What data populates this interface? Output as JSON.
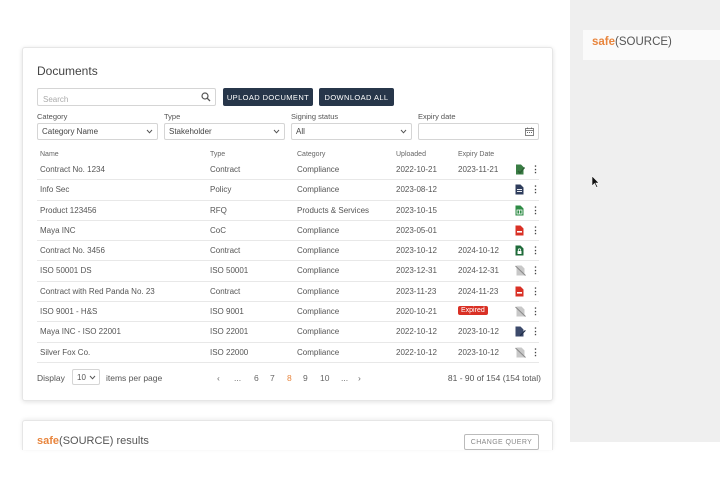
{
  "brand": {
    "safe": "safe",
    "source": "(SOURCE)"
  },
  "documents": {
    "title": "Documents",
    "search_placeholder": "Search",
    "upload_label": "UPLOAD DOCUMENT",
    "download_label": "DOWNLOAD ALL",
    "filters": {
      "category": {
        "label": "Category",
        "value": "Category Name"
      },
      "type": {
        "label": "Type",
        "value": "Stakeholder"
      },
      "signing": {
        "label": "Signing status",
        "value": "All"
      },
      "expiry": {
        "label": "Expiry date",
        "value": ""
      }
    },
    "columns": {
      "name": "Name",
      "type": "Type",
      "category": "Category",
      "uploaded": "Uploaded",
      "expiry": "Expiry Date"
    },
    "rows": [
      {
        "name": "Contract No. 1234",
        "type": "Contract",
        "category": "Compliance",
        "uploaded": "2022-10-21",
        "expiry": "2023-11-21",
        "expired": "",
        "icon": "doc-signed-icon"
      },
      {
        "name": "Info Sec",
        "type": "Policy",
        "category": "Compliance",
        "uploaded": "2023-08-12",
        "expiry": "",
        "expired": "",
        "icon": "doc-file-icon"
      },
      {
        "name": "Product 123456",
        "type": "RFQ",
        "category": "Products & Services",
        "uploaded": "2023-10-15",
        "expiry": "",
        "expired": "",
        "icon": "spreadsheet-file-icon"
      },
      {
        "name": "Maya INC",
        "type": "CoC",
        "category": "Compliance",
        "uploaded": "2023-05-01",
        "expiry": "",
        "expired": "",
        "icon": "pdf-file-icon"
      },
      {
        "name": "Contract No. 3456",
        "type": "Contract",
        "category": "Compliance",
        "uploaded": "2023-10-12",
        "expiry": "2024-10-12",
        "expired": "",
        "icon": "spreadsheet-lock-icon"
      },
      {
        "name": "ISO 50001 DS",
        "type": "ISO 50001",
        "category": "Compliance",
        "uploaded": "2023-12-31",
        "expiry": "2024-12-31",
        "expired": "",
        "icon": "file-unavailable-icon"
      },
      {
        "name": "Contract with Red Panda No. 23",
        "type": "Contract",
        "category": "Compliance",
        "uploaded": "2023-11-23",
        "expiry": "2024-11-23",
        "expired": "",
        "icon": "pdf-file-icon"
      },
      {
        "name": "ISO 9001 - H&S",
        "type": "ISO 9001",
        "category": "Compliance",
        "uploaded": "2020-10-21",
        "expiry": "",
        "expired": "Expired",
        "icon": "file-unavailable-icon"
      },
      {
        "name": "Maya INC - ISO 22001",
        "type": "ISO 22001",
        "category": "Compliance",
        "uploaded": "2022-10-12",
        "expiry": "2023-10-12",
        "expired": "",
        "icon": "doc-edit-icon"
      },
      {
        "name": "Silver Fox Co.",
        "type": "ISO 22000",
        "category": "Compliance",
        "uploaded": "2022-10-12",
        "expiry": "2023-10-12",
        "expired": "",
        "icon": "file-unavailable-icon"
      }
    ],
    "footer": {
      "display_label": "Display",
      "per_page": "10",
      "items_per_page_label": "items per page",
      "pages": [
        "‹",
        "...",
        "6",
        "7",
        "8",
        "9",
        "10",
        "...",
        "›"
      ],
      "current_page": "8",
      "total": "81 - 90 of 154 (154 total)"
    }
  },
  "results": {
    "title_safe": "safe",
    "title_rest": "(SOURCE) results",
    "button_label": "CHANGE QUERY"
  },
  "colors": {
    "accent": "#e8853d",
    "dark_button": "#27364a",
    "expired": "#d93025"
  }
}
